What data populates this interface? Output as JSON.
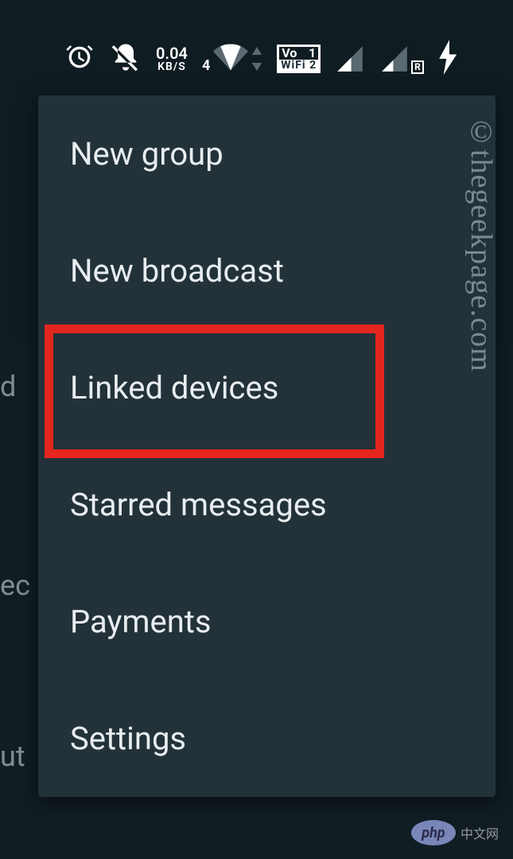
{
  "status_bar": {
    "net_speed_value": "0.04",
    "net_speed_unit": "KB/S",
    "wifi_sub": "4",
    "vowifi_top_left": "Vo",
    "vowifi_top_right": "1",
    "vowifi_bottom": "WiFi 2",
    "signal_r": "R"
  },
  "menu": {
    "items": [
      {
        "label": "New group"
      },
      {
        "label": "New broadcast"
      },
      {
        "label": "Linked devices"
      },
      {
        "label": "Starred messages"
      },
      {
        "label": "Payments"
      },
      {
        "label": "Settings"
      }
    ]
  },
  "background_text": {
    "t1": "d",
    "t2": "ec",
    "t3": "ut"
  },
  "watermark": {
    "side": "©thegeekpage.com",
    "php": "php",
    "php_text": "中文网"
  }
}
